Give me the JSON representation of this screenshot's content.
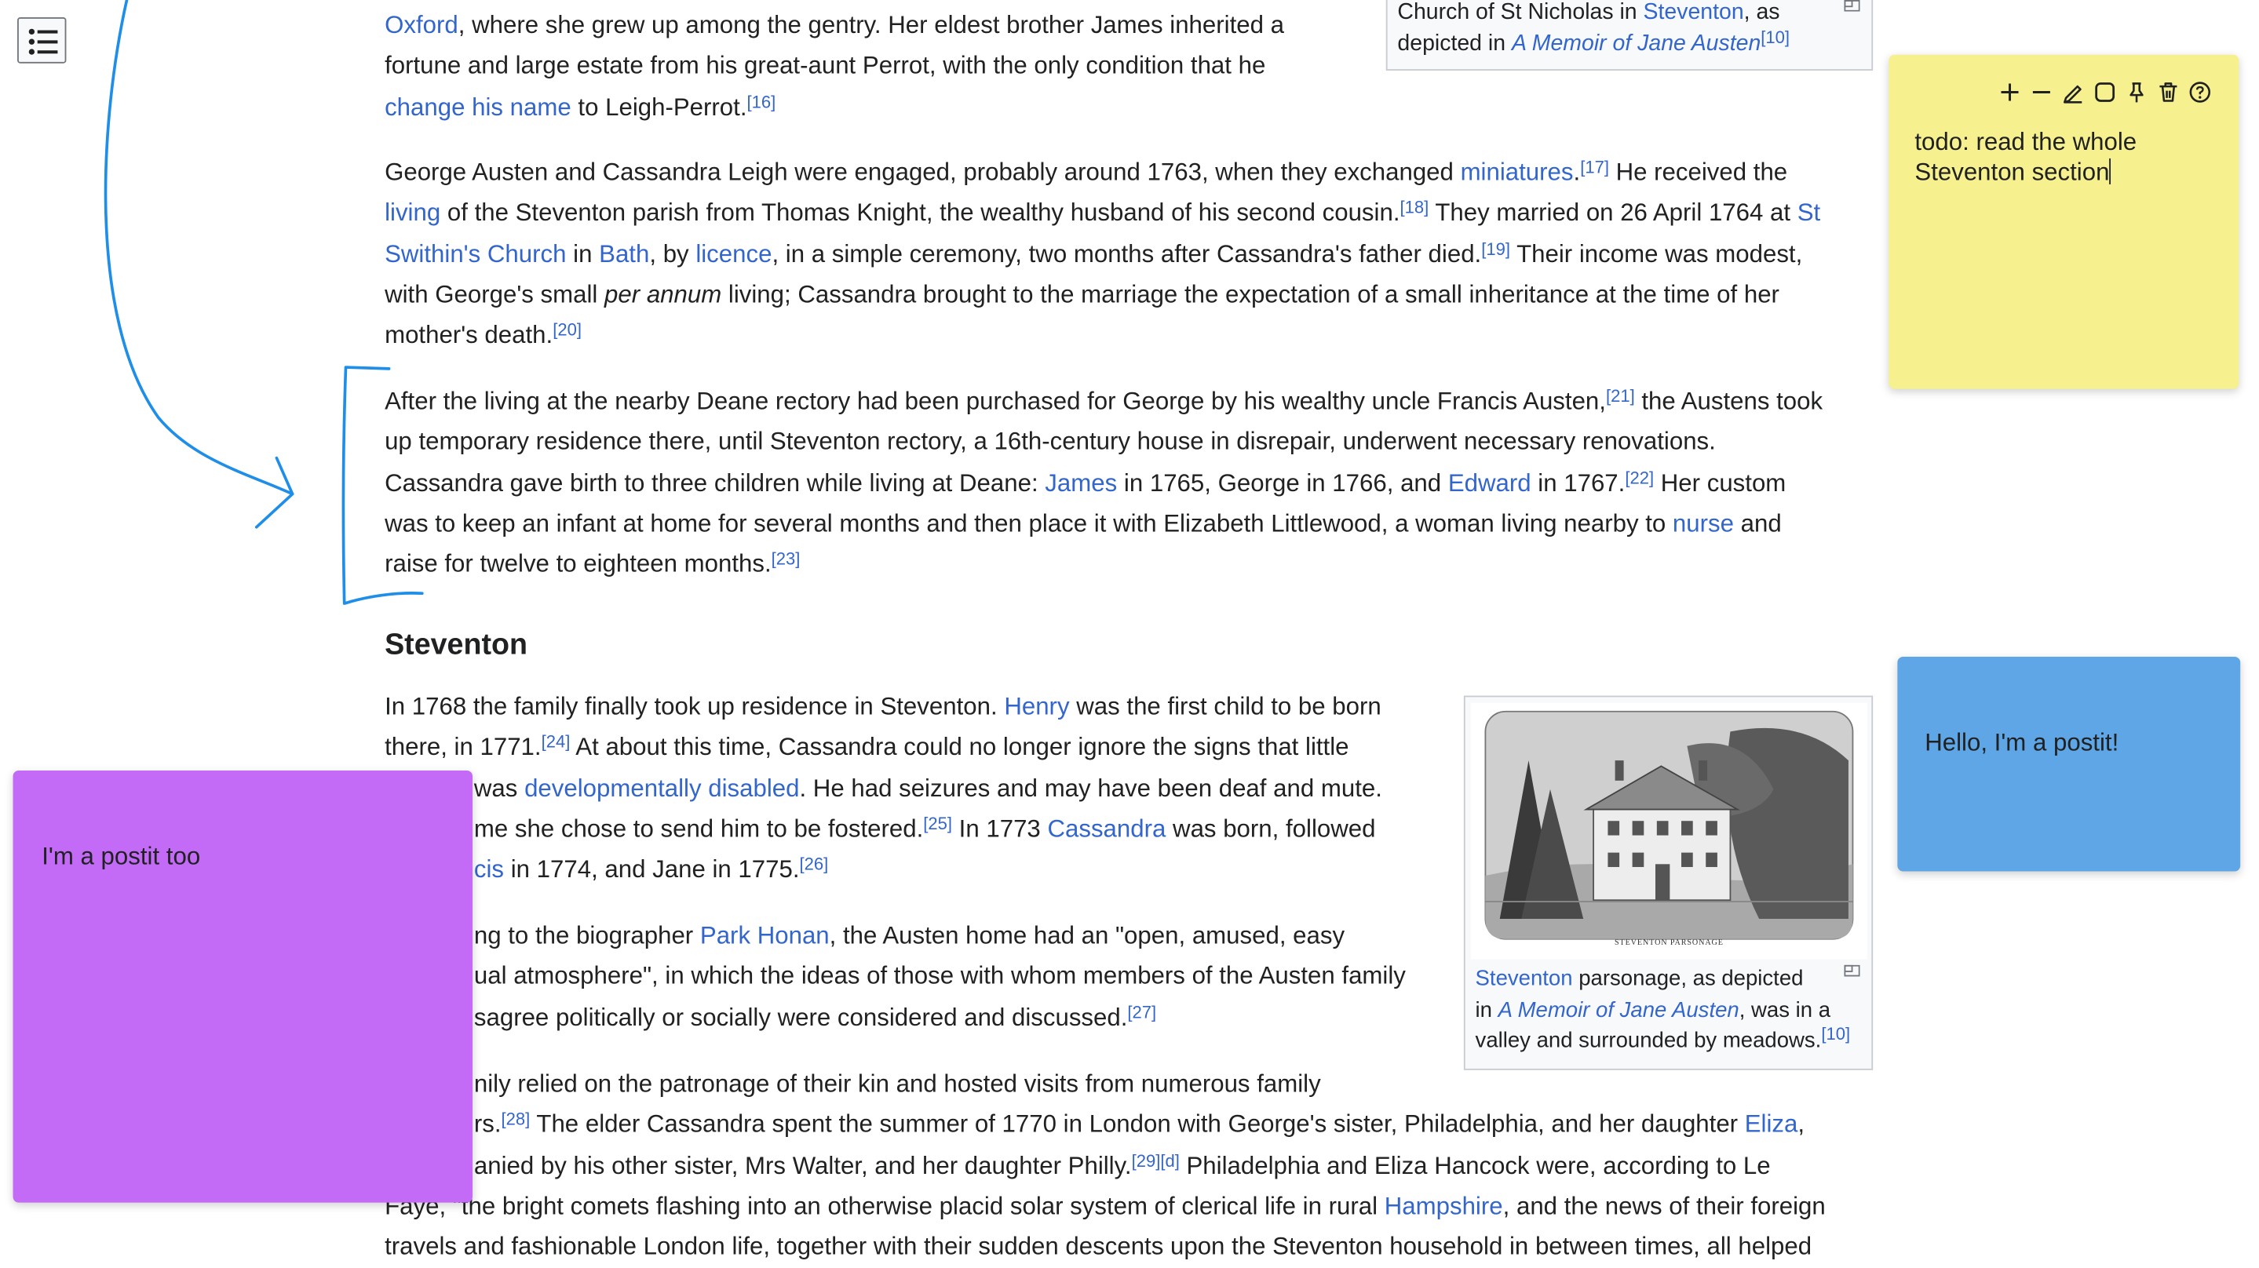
{
  "toc": {
    "icon": "toc-list-icon"
  },
  "top_figure": {
    "caption_pre": "Church of St Nicholas in ",
    "caption_link": "Steventon",
    "caption_mid": ", as",
    "caption_line2_pre": "depicted in ",
    "caption_italic": "A Memoir of Jane Austen",
    "caption_ref": "[10]"
  },
  "p1": {
    "oxford": "Oxford",
    "t1": ", where she grew up among the gentry. Her eldest brother James inherited a",
    "t2": "fortune and large estate from his great-aunt Perrot, with the only condition that he",
    "change_name": "change his name",
    "t3": " to Leigh-Perrot.",
    "ref16": "[16]"
  },
  "p2": {
    "t1": "George Austen and Cassandra Leigh were engaged, probably around 1763, when they exchanged ",
    "miniatures": "miniatures",
    "t1b": ".",
    "ref17": "[17]",
    "t1c": " He received the",
    "living": "living",
    "t2": " of the Steventon parish from Thomas Knight, the wealthy husband of his second cousin.",
    "ref18": "[18]",
    "t2b": " They married on 26 April 1764 at ",
    "st": "St",
    "swithin": "Swithin's Church",
    "t3a": " in ",
    "bath": "Bath",
    "t3b": ", by ",
    "licence": "licence",
    "t3c": ", in a simple ceremony, two months after Cassandra's father died.",
    "ref19": "[19]",
    "t3d": " Their income was modest,",
    "t4a": "with George's small ",
    "per_annum": "per annum",
    "t4b": " living; Cassandra brought to the marriage the expectation of a small inheritance at the time of her",
    "t5": "mother's death.",
    "ref20": "[20]"
  },
  "p3": {
    "t1": "After the living at the nearby Deane rectory had been purchased for George by his wealthy uncle Francis Austen,",
    "ref21": "[21]",
    "t1b": " the Austens took",
    "t2": "up temporary residence there, until Steventon rectory, a 16th-century house in disrepair, underwent necessary renovations.",
    "t3a": "Cassandra gave birth to three children while living at Deane: ",
    "james": "James",
    "t3b": " in 1765, George in 1766, and ",
    "edward": "Edward",
    "t3c": " in 1767.",
    "ref22": "[22]",
    "t3d": " Her custom",
    "t4a": "was to keep an infant at home for several months and then place it with Elizabeth Littlewood, a woman living nearby to ",
    "nurse": "nurse",
    "t4b": " and",
    "t5": "raise for twelve to eighteen months.",
    "ref23": "[23]"
  },
  "heading": "Steventon",
  "p4": {
    "t1a": "In 1768 the family finally took up residence in Steventon. ",
    "henry": "Henry",
    "t1b": " was the first child to be born",
    "t2a": "there, in 1771.",
    "ref24": "[24]",
    "t2b": " At about this time, Cassandra could no longer ignore the signs that little",
    "t3a": "was ",
    "dev": "developmentally disabled",
    "t3b": ". He had seizures and may have been deaf and mute.",
    "t4a": "me she chose to send him to be fostered.",
    "ref25": "[25]",
    "t4b": " In 1773 ",
    "cassandra": "Cassandra",
    "t4c": " was born, followed",
    "francis": "cis",
    "t5a": " in 1774, and Jane in 1775.",
    "ref26": "[26]"
  },
  "p5": {
    "t1a": "ng to the biographer ",
    "honan": "Park Honan",
    "t1b": ", the Austen home had an \"open, amused, easy",
    "t2": "ual atmosphere\", in which the ideas of those with whom members of the Austen family",
    "t3": "sagree politically or socially were considered and discussed.",
    "ref27": "[27]"
  },
  "p6": {
    "t1": "nily relied on the patronage of their kin and hosted visits from numerous family",
    "t2a": "rs.",
    "ref28": "[28]",
    "t2b": " The elder Cassandra spent the summer of 1770 in London with George's sister, Philadelphia, and her daughter ",
    "eliza": "Eliza",
    "t2c": ",",
    "t3a": "anied by his other sister, Mrs Walter, and her daughter Philly.",
    "ref29": "[29]",
    "refd": "[d]",
    "t3b": " Philadelphia and Eliza Hancock were, according to Le",
    "t4a": "Faye, \"the bright comets flashing into an otherwise placid solar system of clerical life in rural ",
    "hampshire": "Hampshire",
    "t4b": ", and the news of their foreign",
    "t5": "travels and fashionable London life, together with their sudden descents upon the Steventon household in between times, all helped"
  },
  "parsonage_figure": {
    "engraving_label": "STEVENTON PARSONAGE",
    "link": "Steventon",
    "t1": " parsonage, as depicted",
    "t2a": "in ",
    "italic": "A Memoir of Jane Austen",
    "t2b": ", was in a",
    "t3": "valley and surrounded by meadows.",
    "ref": "[10]"
  },
  "postits": {
    "yellow": {
      "text_line1": "todo: read the whole",
      "text_line2": "Steventon section",
      "color": "#f7f08e",
      "toolbar": [
        "plus-icon",
        "minus-icon",
        "pen-icon",
        "square-icon",
        "pin-icon",
        "trash-icon",
        "help-icon"
      ]
    },
    "blue": {
      "text": "Hello, I'm a postit!",
      "color": "#5fa6e6"
    },
    "purple": {
      "text": "I'm a postit too",
      "color": "#c36af7"
    }
  },
  "annotations": {
    "stroke_color": "#1e8ee8"
  }
}
